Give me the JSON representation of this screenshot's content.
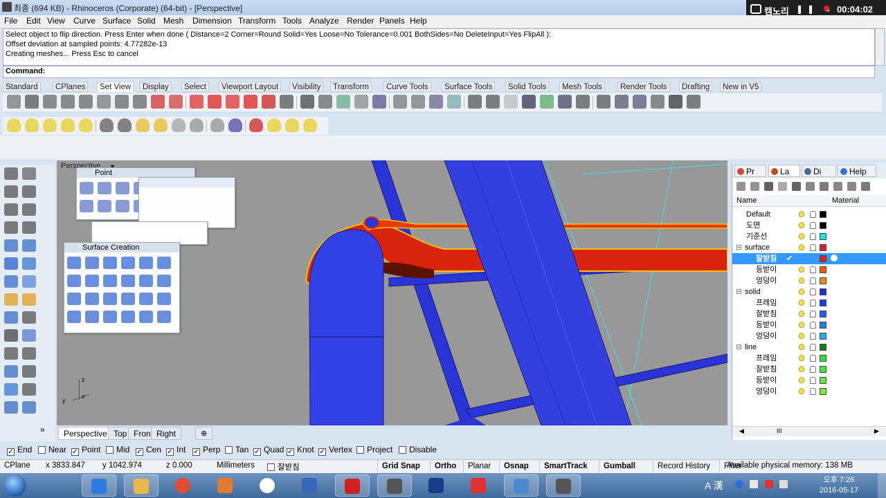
{
  "window": {
    "title": "최종 (694 KB) - Rhinoceros (Corporate) (64-bit) - [Perspective]"
  },
  "recorder": {
    "name": "캠노리",
    "controls": "❚❚ ■",
    "time": "00:04:02"
  },
  "menu": [
    "File",
    "Edit",
    "View",
    "Curve",
    "Surface",
    "Solid",
    "Mesh",
    "Dimension",
    "Transform",
    "Tools",
    "Analyze",
    "Render",
    "Panels",
    "Help"
  ],
  "command": {
    "history": [
      "Select object to flip direction. Press Enter when done ( Distance=2  Corner=Round  Solid=Yes  Loose=No  Tolerance=0.001  BothSides=No  DeleteInput=Yes  FlipAll ):",
      "Offset deviation at sampled points: 4.77282e-13",
      "Creating meshes... Press Esc to cancel"
    ],
    "prompt": "Command:"
  },
  "toolbar_tabs": [
    "Standard",
    "CPlanes",
    "Set View",
    "Display",
    "Select",
    "Viewport Layout",
    "Visibility",
    "Transform",
    "Curve Tools",
    "Surface Tools",
    "Solid Tools",
    "Mesh Tools",
    "Render Tools",
    "Drafting",
    "New in V5"
  ],
  "active_tab": "Set View",
  "viewport": {
    "label": "Perspective",
    "axis_z": "z",
    "axis_x": "x",
    "axis_y": "y"
  },
  "flyouts": {
    "point": "Point",
    "surface": "Surface Creation"
  },
  "viewport_tabs": [
    "Perspective",
    "Top",
    "Front",
    "Right"
  ],
  "panel": {
    "tabs": [
      "Pr",
      "La",
      "Di",
      "Help"
    ],
    "col_name": "Name",
    "col_material": "Material",
    "layers": [
      {
        "name": "Default",
        "indent": 1,
        "color": "#000000",
        "current": false,
        "selected": false
      },
      {
        "name": "도면",
        "indent": 1,
        "color": "#000000",
        "current": false,
        "selected": false
      },
      {
        "name": "기준선",
        "indent": 1,
        "color": "#22e0e8",
        "current": false,
        "selected": false
      },
      {
        "name": "surface",
        "indent": 0,
        "color": "#e02020",
        "current": false,
        "selected": false,
        "expander": "−"
      },
      {
        "name": "잘받침",
        "indent": 2,
        "color": "#e02020",
        "current": true,
        "selected": true
      },
      {
        "name": "등받이",
        "indent": 2,
        "color": "#e85a10",
        "current": false,
        "selected": false
      },
      {
        "name": "엉덩이",
        "indent": 2,
        "color": "#f08a20",
        "current": false,
        "selected": false
      },
      {
        "name": "solid",
        "indent": 0,
        "color": "#1830e0",
        "current": false,
        "selected": false,
        "expander": "−"
      },
      {
        "name": "프레임",
        "indent": 2,
        "color": "#1840e8",
        "current": false,
        "selected": false
      },
      {
        "name": "잘받침",
        "indent": 2,
        "color": "#2060e8",
        "current": false,
        "selected": false
      },
      {
        "name": "등받이",
        "indent": 2,
        "color": "#2080e8",
        "current": false,
        "selected": false
      },
      {
        "name": "엉덩이",
        "indent": 2,
        "color": "#20b0e8",
        "current": false,
        "selected": false
      },
      {
        "name": "line",
        "indent": 0,
        "color": "#108010",
        "current": false,
        "selected": false,
        "expander": "−"
      },
      {
        "name": "프레임",
        "indent": 2,
        "color": "#30e030",
        "current": false,
        "selected": false
      },
      {
        "name": "잘받침",
        "indent": 2,
        "color": "#40e840",
        "current": false,
        "selected": false
      },
      {
        "name": "등받이",
        "indent": 2,
        "color": "#60e840",
        "current": false,
        "selected": false
      },
      {
        "name": "엉덩이",
        "indent": 2,
        "color": "#80e830",
        "current": false,
        "selected": false
      }
    ],
    "scroll_label": "III"
  },
  "osnap": [
    {
      "label": "End",
      "checked": true
    },
    {
      "label": "Near",
      "checked": false
    },
    {
      "label": "Point",
      "checked": true
    },
    {
      "label": "Mid",
      "checked": false
    },
    {
      "label": "Cen",
      "checked": true
    },
    {
      "label": "Int",
      "checked": true
    },
    {
      "label": "Perp",
      "checked": true
    },
    {
      "label": "Tan",
      "checked": false
    },
    {
      "label": "Quad",
      "checked": true
    },
    {
      "label": "Knot",
      "checked": true
    },
    {
      "label": "Vertex",
      "checked": true
    },
    {
      "label": "Project",
      "checked": false
    },
    {
      "label": "Disable",
      "checked": false
    }
  ],
  "status": {
    "cplane": "CPlane",
    "x": "x 3833.847",
    "y": "y 1042.974",
    "z": "z 0.000",
    "units": "Millimeters",
    "layer": "잘받침",
    "buttons": [
      "Grid Snap",
      "Ortho",
      "Planar",
      "Osnap",
      "SmartTrack",
      "Gumball",
      "Record History",
      "Filter"
    ],
    "bold_buttons": [
      "Grid Snap",
      "Ortho",
      "Osnap",
      "SmartTrack",
      "Gumball"
    ],
    "memory": "Available physical memory: 138 MB"
  },
  "taskbar": {
    "time": "오후 7:26",
    "date": "2016-05-17",
    "ime": "A 漢"
  }
}
